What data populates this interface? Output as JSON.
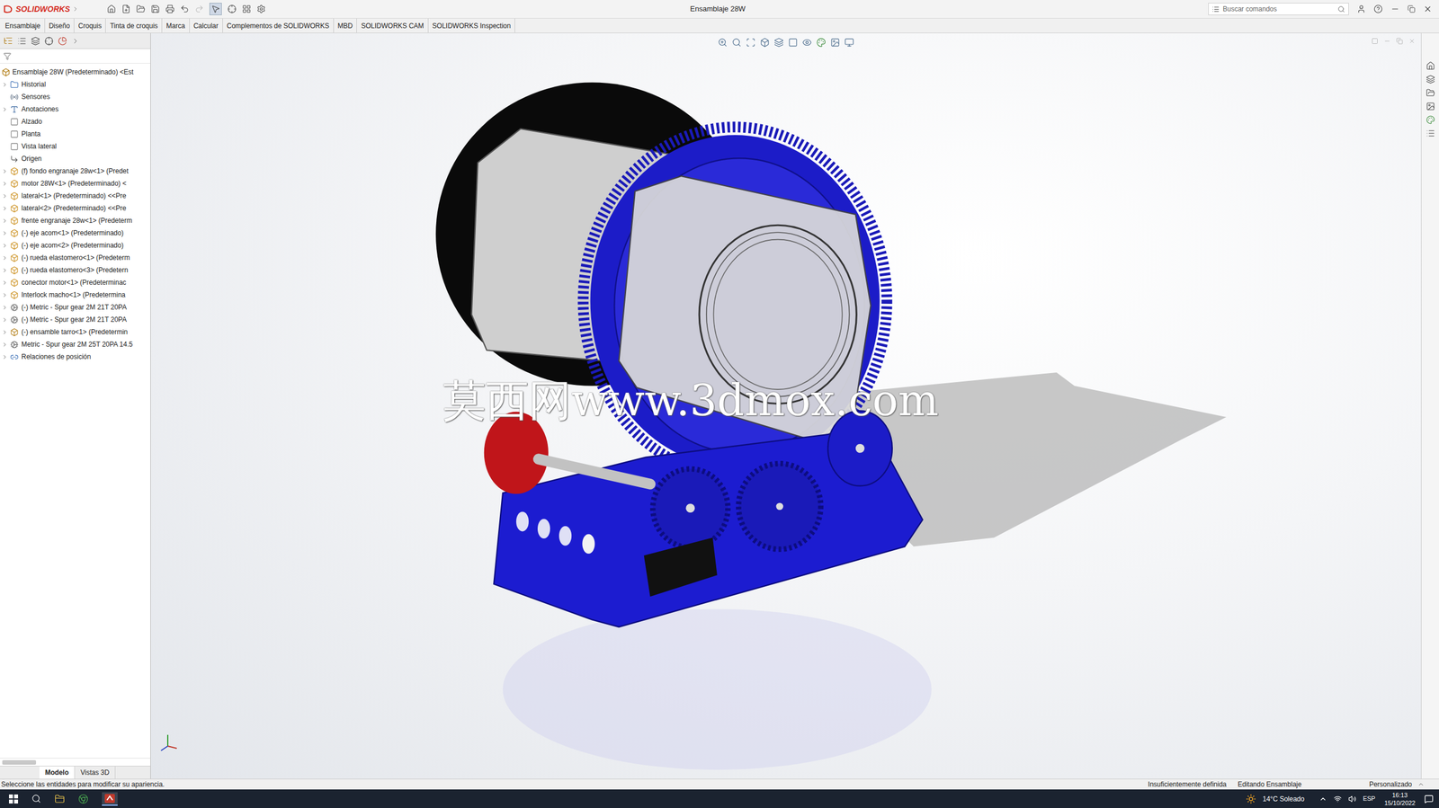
{
  "app": {
    "logo": "SOLIDWORKS"
  },
  "window": {
    "title": "Ensamblaje 28W"
  },
  "search": {
    "placeholder": "Buscar comandos"
  },
  "tabs": [
    {
      "label": "Ensamblaje"
    },
    {
      "label": "Diseño"
    },
    {
      "label": "Croquis"
    },
    {
      "label": "Tinta de croquis"
    },
    {
      "label": "Marca"
    },
    {
      "label": "Calcular"
    },
    {
      "label": "Complementos de SOLIDWORKS"
    },
    {
      "label": "MBD"
    },
    {
      "label": "SOLIDWORKS CAM"
    },
    {
      "label": "SOLIDWORKS Inspection"
    }
  ],
  "tree": {
    "root": "Ensamblaje 28W (Predeterminado) <Est",
    "items": [
      {
        "label": "Historial",
        "kind": "folder",
        "expandable": true
      },
      {
        "label": "Sensores",
        "kind": "sensor",
        "expandable": false
      },
      {
        "label": "Anotaciones",
        "kind": "annotation",
        "expandable": true
      },
      {
        "label": "Alzado",
        "kind": "plane",
        "expandable": false
      },
      {
        "label": "Planta",
        "kind": "plane",
        "expandable": false
      },
      {
        "label": "Vista lateral",
        "kind": "plane",
        "expandable": false
      },
      {
        "label": "Origen",
        "kind": "origin",
        "expandable": false
      },
      {
        "label": "(f) fondo engranaje 28w<1> (Predet",
        "kind": "part",
        "expandable": true
      },
      {
        "label": "motor 28W<1> (Predeterminado) <",
        "kind": "part",
        "expandable": true
      },
      {
        "label": "lateral<1> (Predeterminado) <<Pre",
        "kind": "part",
        "expandable": true
      },
      {
        "label": "lateral<2> (Predeterminado) <<Pre",
        "kind": "part",
        "expandable": true
      },
      {
        "label": "frente engranaje 28w<1> (Predeterm",
        "kind": "part",
        "expandable": true
      },
      {
        "label": "(-) eje acom<1> (Predeterminado)",
        "kind": "part",
        "expandable": true
      },
      {
        "label": "(-) eje acom<2> (Predeterminado)",
        "kind": "part",
        "expandable": true
      },
      {
        "label": "(-) rueda elastomero<1> (Predeterm",
        "kind": "part",
        "expandable": true
      },
      {
        "label": "(-) rueda elastomero<3> (Predetern",
        "kind": "part",
        "expandable": true
      },
      {
        "label": "conector motor<1> (Predeterminac",
        "kind": "part",
        "expandable": true
      },
      {
        "label": "Interlock macho<1> (Predetermina",
        "kind": "part",
        "expandable": true
      },
      {
        "label": "(-) Metric - Spur gear 2M 21T 20PA",
        "kind": "gear",
        "expandable": true
      },
      {
        "label": "(-) Metric - Spur gear 2M 21T 20PA",
        "kind": "gear",
        "expandable": true
      },
      {
        "label": "(-) ensamble tarro<1> (Predetermin",
        "kind": "assembly",
        "expandable": true
      },
      {
        "label": "Metric - Spur gear 2M 25T 20PA 14.5",
        "kind": "gear",
        "expandable": true
      },
      {
        "label": "Relaciones de posición",
        "kind": "mates",
        "expandable": true
      }
    ]
  },
  "panel_tabs": [
    {
      "label": "Modelo",
      "selected": true
    },
    {
      "label": "Vistas 3D",
      "selected": false
    }
  ],
  "watermark": "莫西网www.3dmox.com",
  "status_bar": {
    "message": "Seleccione las entidades para modificar su apariencia.",
    "definition": "Insuficientemente definida",
    "mode": "Editando Ensamblaje",
    "units": "Personalizado"
  },
  "taskbar": {
    "weather": "14°C Soleado",
    "language": "ESP",
    "time": "16:13",
    "date": "15/10/2022"
  }
}
